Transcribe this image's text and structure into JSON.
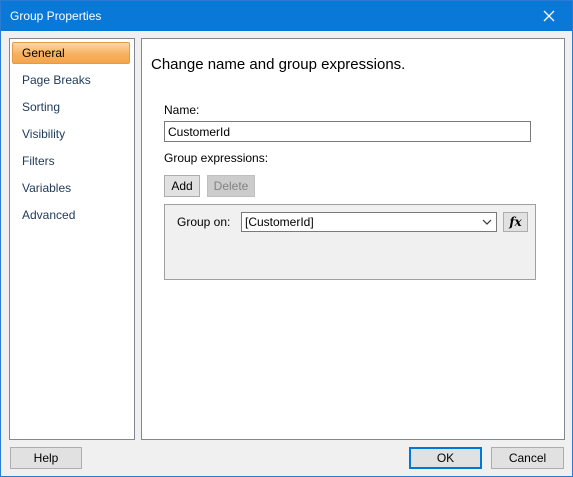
{
  "window": {
    "title": "Group Properties"
  },
  "nav": {
    "items": [
      {
        "label": "General",
        "selected": true
      },
      {
        "label": "Page Breaks"
      },
      {
        "label": "Sorting"
      },
      {
        "label": "Visibility"
      },
      {
        "label": "Filters"
      },
      {
        "label": "Variables"
      },
      {
        "label": "Advanced"
      }
    ]
  },
  "general": {
    "heading": "Change name and group expressions.",
    "name_label": "Name:",
    "name_value": "CustomerId",
    "group_expressions_label": "Group expressions:",
    "add_label": "Add",
    "delete_label": "Delete",
    "group_on_label": "Group on:",
    "group_on_value": "[CustomerId]",
    "fx_label": "fx"
  },
  "buttons": {
    "help": "Help",
    "ok": "OK",
    "cancel": "Cancel"
  },
  "colors": {
    "titlebar": "#0a78d7",
    "selected_nav": "#f6b160",
    "default_button_border": "#0078d7"
  },
  "icons": {
    "close": "close-icon",
    "dropdown": "chevron-down-icon",
    "function": "function-icon"
  }
}
